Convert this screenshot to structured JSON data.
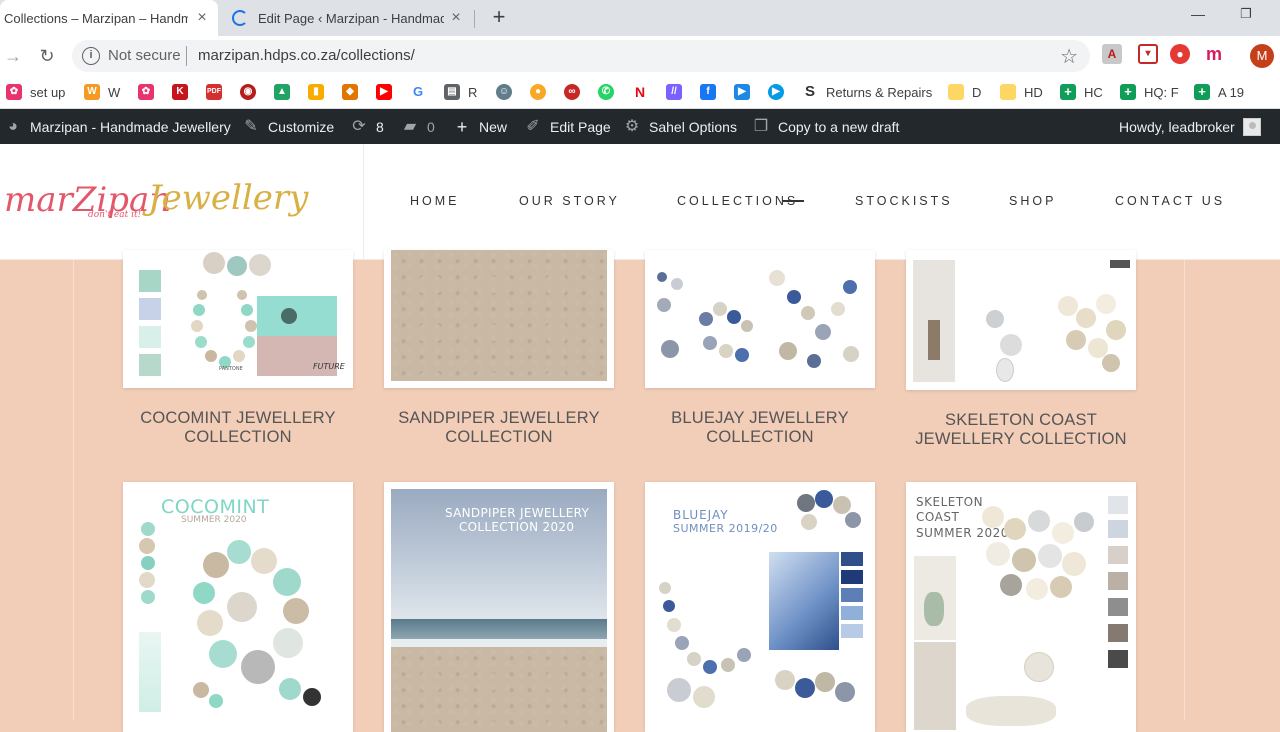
{
  "browser": {
    "tabs": [
      {
        "title": "Collections – Marzipan – Handmade Jewellery",
        "active": true
      },
      {
        "title": "Edit Page ‹ Marzipan - Handmade Jewellery",
        "active": false
      }
    ],
    "address": {
      "security_label": "Not secure",
      "url": "marzipan.hdps.co.za/collections/"
    },
    "profile_initial": "M",
    "bookmarks": [
      {
        "label": "set up",
        "icon": "butterfly-icon",
        "color": "#e8336d"
      },
      {
        "label": "W",
        "icon": "w-icon",
        "color": "#f59a23"
      },
      {
        "label": "",
        "icon": "butterfly-icon",
        "color": "#e8336d"
      },
      {
        "label": "",
        "icon": "k-icon",
        "color": "#c4161c"
      },
      {
        "label": "",
        "icon": "pdf-icon",
        "color": "#d32f2f"
      },
      {
        "label": "",
        "icon": "lips-icon",
        "color": "#b71c1c"
      },
      {
        "label": "",
        "icon": "drive-icon",
        "color": "#1fa463"
      },
      {
        "label": "",
        "icon": "analytics-icon",
        "color": "#f9ab00"
      },
      {
        "label": "",
        "icon": "diamond-icon",
        "color": "#e37400"
      },
      {
        "label": "",
        "icon": "youtube-icon",
        "color": "#ff0000"
      },
      {
        "label": "",
        "icon": "google-icon",
        "color": "#4285f4"
      },
      {
        "label": "R",
        "icon": "r-icon",
        "color": "#5f6368"
      },
      {
        "label": "",
        "icon": "bot-icon",
        "color": "#607d8b"
      },
      {
        "label": "",
        "icon": "bee-icon",
        "color": "#f9a825"
      },
      {
        "label": "",
        "icon": "link-icon",
        "color": "#c62828"
      },
      {
        "label": "",
        "icon": "whatsapp-icon",
        "color": "#25d366"
      },
      {
        "label": "",
        "icon": "netflix-icon",
        "color": "#e50914"
      },
      {
        "label": "",
        "icon": "slash-icon",
        "color": "#7b61ff"
      },
      {
        "label": "",
        "icon": "facebook-icon",
        "color": "#1877f2"
      },
      {
        "label": "",
        "icon": "play-icon",
        "color": "#1e88e5"
      },
      {
        "label": "",
        "icon": "play-circle-icon",
        "color": "#039be5"
      },
      {
        "label": "Returns & Repairs",
        "icon": "s-icon",
        "color": "#333333"
      },
      {
        "label": "D",
        "icon": "folder-icon",
        "color": "#fdd663"
      },
      {
        "label": "HD",
        "icon": "folder-icon",
        "color": "#fdd663"
      },
      {
        "label": "HC",
        "icon": "sheets-icon",
        "color": "#0f9d58"
      },
      {
        "label": "HQ: F",
        "icon": "sheets-icon",
        "color": "#0f9d58"
      },
      {
        "label": "A 19",
        "icon": "sheets-icon",
        "color": "#0f9d58"
      }
    ]
  },
  "adminbar": {
    "site_name": "Marzipan - Handmade Jewellery",
    "customize": "Customize",
    "updates_count": "8",
    "comments_count": "0",
    "new": "New",
    "edit_page": "Edit Page",
    "theme_options": "Sahel Options",
    "copy_draft": "Copy to a new draft",
    "greeting": "Howdy, leadbroker"
  },
  "site": {
    "logo_word1": "marZipan",
    "logo_word2": "Jewellery",
    "logo_tagline": "don't eat it!",
    "nav": [
      "HOME",
      "OUR STORY",
      "COLLECTIONS",
      "STOCKISTS",
      "SHOP",
      "CONTACT US"
    ],
    "active_nav": "COLLECTIONS"
  },
  "collections": [
    {
      "title": "COCOMINT JEWELLERY COLLECTION",
      "poster_title": "COCOMINT",
      "poster_subtitle": "SUMMER 2020",
      "moodboard_label": "FUTURE",
      "moodboard_brand": "PANTONE"
    },
    {
      "title": "SANDPIPER JEWELLERY COLLECTION",
      "poster_title": "SANDPIPER JEWELLERY",
      "poster_subtitle": "COLLECTION 2020"
    },
    {
      "title": "BLUEJAY JEWELLERY COLLECTION",
      "poster_title": "BLUEJAY",
      "poster_subtitle": "SUMMER 2019/20"
    },
    {
      "title": "SKELETON COAST JEWELLERY COLLECTION",
      "poster_title": "SKELETON COAST",
      "poster_subtitle": "SUMMER 2020"
    }
  ],
  "colors": {
    "page_bg": "#f2cdb8",
    "adminbar_bg": "#23282d",
    "logo_pink": "#e4576b",
    "logo_gold": "#d8b043",
    "cocomint": "#7fd6c4",
    "bluejay": "#3a5a9a"
  }
}
